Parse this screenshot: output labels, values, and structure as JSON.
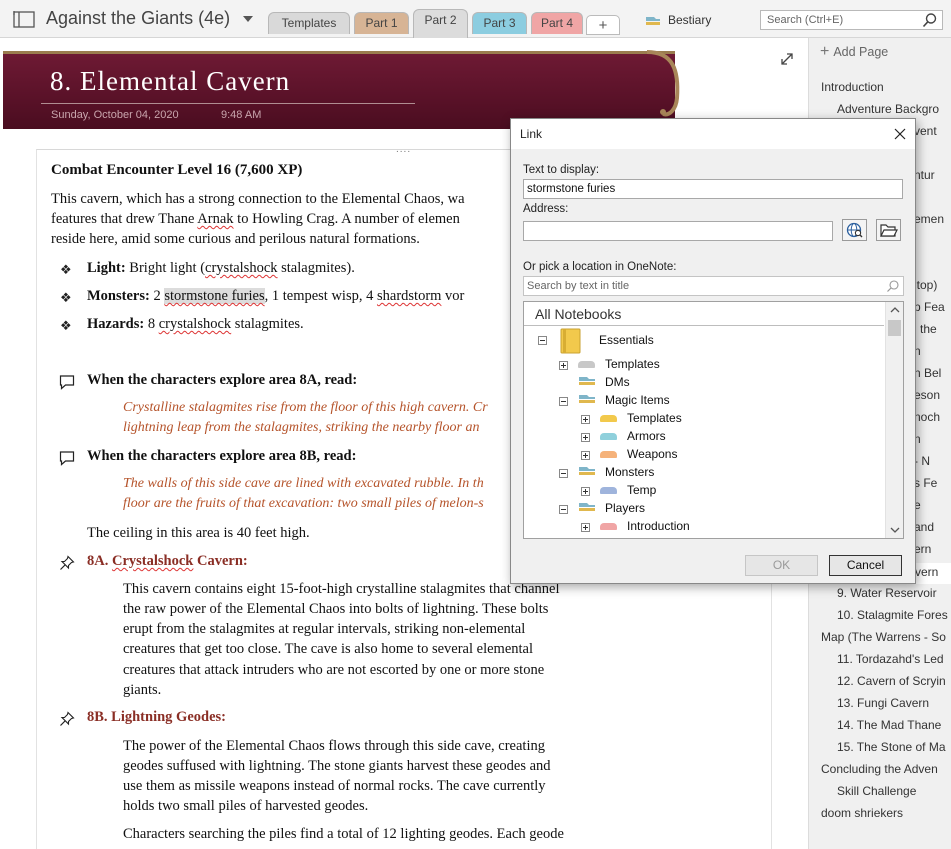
{
  "topbar": {
    "notebook_title": "Against the Giants (4e)",
    "tabs": [
      {
        "label": "Templates",
        "color": "#d9d9d9"
      },
      {
        "label": "Part 1",
        "color": "#d7b495"
      },
      {
        "label": "Part 2",
        "color": "#dcdcdc"
      },
      {
        "label": "Part 3",
        "color": "#8ccde0"
      },
      {
        "label": "Part 4",
        "color": "#f0a5a5"
      }
    ],
    "add_tab_label": "+",
    "bestiary_label": "Bestiary",
    "search_placeholder": "Search (Ctrl+E)"
  },
  "page": {
    "title": "8. Elemental Cavern",
    "date": "Sunday, October 04, 2020",
    "time": "9:48 AM",
    "handle": "....",
    "encounter_heading": "Combat Encounter Level 16 (7,600 XP)",
    "intro_line1": "This cavern, which has a strong connection to the Elemental Chaos, wa",
    "intro_line2_a": "features that drew Thane ",
    "intro_line2_b": "Arnak",
    "intro_line2_c": " to Howling Crag. A number of elemen",
    "intro_line3": "reside here, amid some curious and perilous natural formations.",
    "light_label": "Light:",
    "light_text_a": " Bright light (",
    "light_text_b": "crystalshock",
    "light_text_c": " stalagmites).",
    "monsters_label": "Monsters:",
    "monsters_text_a": " 2 ",
    "monsters_text_b": "stormstone furies",
    "monsters_text_c": ", 1 tempest wisp, 4 ",
    "monsters_text_d": "shardstorm",
    "monsters_text_e": " vor",
    "hazards_label": "Hazards:",
    "hazards_text_a": " 8 ",
    "hazards_text_b": "crystalshock",
    "hazards_text_c": " stalagmites.",
    "read_8a": "When the characters explore area 8A, read:",
    "read_8a_line1": "Crystalline stalagmites rise from the floor of this high cavern. Cr",
    "read_8a_line2": "lightning leap from the stalagmites, striking the nearby floor an",
    "read_8b": "When the characters explore area 8B, read:",
    "read_8b_line1": "The walls of this side cave are lined with excavated rubble. In th",
    "read_8b_line2": "floor are the fruits of that excavation: two small piles of melon-s",
    "ceiling_text": "The ceiling in this area is 40 feet high.",
    "sec_8a_prefix": "8A. ",
    "sec_8a_word": "Crystalshock",
    "sec_8a_suffix": " Cavern:",
    "sec_8a_lines": [
      "This cavern contains eight 15-foot-high crystalline stalagmites that channel",
      "the raw power of the Elemental Chaos into bolts of lightning. These bolts",
      "erupt from the stalagmites at regular intervals, striking non-elemental",
      "creatures that get too close. The cave is also home to several elemental",
      "creatures that attack intruders who are not escorted by one or more stone",
      "giants."
    ],
    "sec_8b_title": "8B. Lightning Geodes:",
    "sec_8b_lines": [
      "The power of the Elemental Chaos flows through this side cave, creating",
      "geodes suffused with lightning. The stone giants harvest these geodes and",
      "use them as missile weapons instead of normal rocks. The cave currently",
      "holds two small piles of harvested geodes."
    ],
    "sec_8b_last": "Characters searching the piles find a total of 12 lighting geodes. Each geode"
  },
  "pages_panel": {
    "add_page_label": "Add Page",
    "items": [
      {
        "label": "Introduction",
        "indent": 0
      },
      {
        "label": "Adventure Backgro",
        "indent": 1
      },
      {
        "label": "vent",
        "indent": 2
      },
      {
        "label": "ntur",
        "indent": 2
      },
      {
        "label": "emen",
        "indent": 2
      },
      {
        "label": "ltop)",
        "indent": 2
      },
      {
        "label": "p Fea",
        "indent": 2
      },
      {
        "label": "the",
        "indent": 2
      },
      {
        "label": "n",
        "indent": 2
      },
      {
        "label": "n Bel",
        "indent": 2
      },
      {
        "label": "eson",
        "indent": 2
      },
      {
        "label": "noch",
        "indent": 2
      },
      {
        "label": "n",
        "indent": 2
      },
      {
        "label": "- N",
        "indent": 2
      },
      {
        "label": "s Fe",
        "indent": 2
      },
      {
        "label": "e",
        "indent": 2
      },
      {
        "label": "and",
        "indent": 2
      },
      {
        "label": "ern",
        "indent": 2
      },
      {
        "label": "vern",
        "indent": 2
      },
      {
        "label": "9. Water Reservoir",
        "indent": 1
      },
      {
        "label": "10. Stalagmite Fores",
        "indent": 1
      },
      {
        "label": "Map (The Warrens - So",
        "indent": 0
      },
      {
        "label": "11. Tordazahd's Led",
        "indent": 1
      },
      {
        "label": "12. Cavern of Scryin",
        "indent": 1
      },
      {
        "label": "13. Fungi Cavern",
        "indent": 1
      },
      {
        "label": "14. The Mad Thane",
        "indent": 1
      },
      {
        "label": "15. The Stone of Ma",
        "indent": 1
      },
      {
        "label": "Concluding the Adven",
        "indent": 0
      },
      {
        "label": "Skill Challenge",
        "indent": 1
      },
      {
        "label": "doom shriekers",
        "indent": 0
      }
    ]
  },
  "dialog": {
    "title": "Link",
    "text_label": "Text to display:",
    "text_value": "stormstone furies",
    "address_label": "Address:",
    "address_value": "",
    "pick_label": "Or pick a location in OneNote:",
    "search_placeholder": "Search by text in title",
    "tree_root": "All Notebooks",
    "tree": [
      {
        "label": "Essentials",
        "level": 0,
        "expander": "minus",
        "kind": "notebook",
        "color": "#f2c94c"
      },
      {
        "label": "Templates",
        "level": 1,
        "expander": "plus",
        "kind": "section",
        "color": "#c8c8c8"
      },
      {
        "label": "DMs",
        "level": 1,
        "expander": "",
        "kind": "group",
        "color": "#7fb5c9"
      },
      {
        "label": "Magic Items",
        "level": 1,
        "expander": "minus",
        "kind": "group",
        "color": "#7fb5c9"
      },
      {
        "label": "Templates",
        "level": 2,
        "expander": "plus",
        "kind": "section",
        "color": "#f2c94c"
      },
      {
        "label": "Armors",
        "level": 2,
        "expander": "plus",
        "kind": "section",
        "color": "#8fd0dc"
      },
      {
        "label": "Weapons",
        "level": 2,
        "expander": "plus",
        "kind": "section",
        "color": "#f5b27a"
      },
      {
        "label": "Monsters",
        "level": 1,
        "expander": "minus",
        "kind": "group",
        "color": "#7fb5c9"
      },
      {
        "label": "Temp",
        "level": 2,
        "expander": "plus",
        "kind": "section",
        "color": "#9fb4dc"
      },
      {
        "label": "Players",
        "level": 1,
        "expander": "minus",
        "kind": "group",
        "color": "#7fb5c9"
      },
      {
        "label": "Introduction",
        "level": 2,
        "expander": "plus",
        "kind": "section",
        "color": "#f0a5a5"
      }
    ],
    "ok_label": "OK",
    "cancel_label": "Cancel"
  }
}
